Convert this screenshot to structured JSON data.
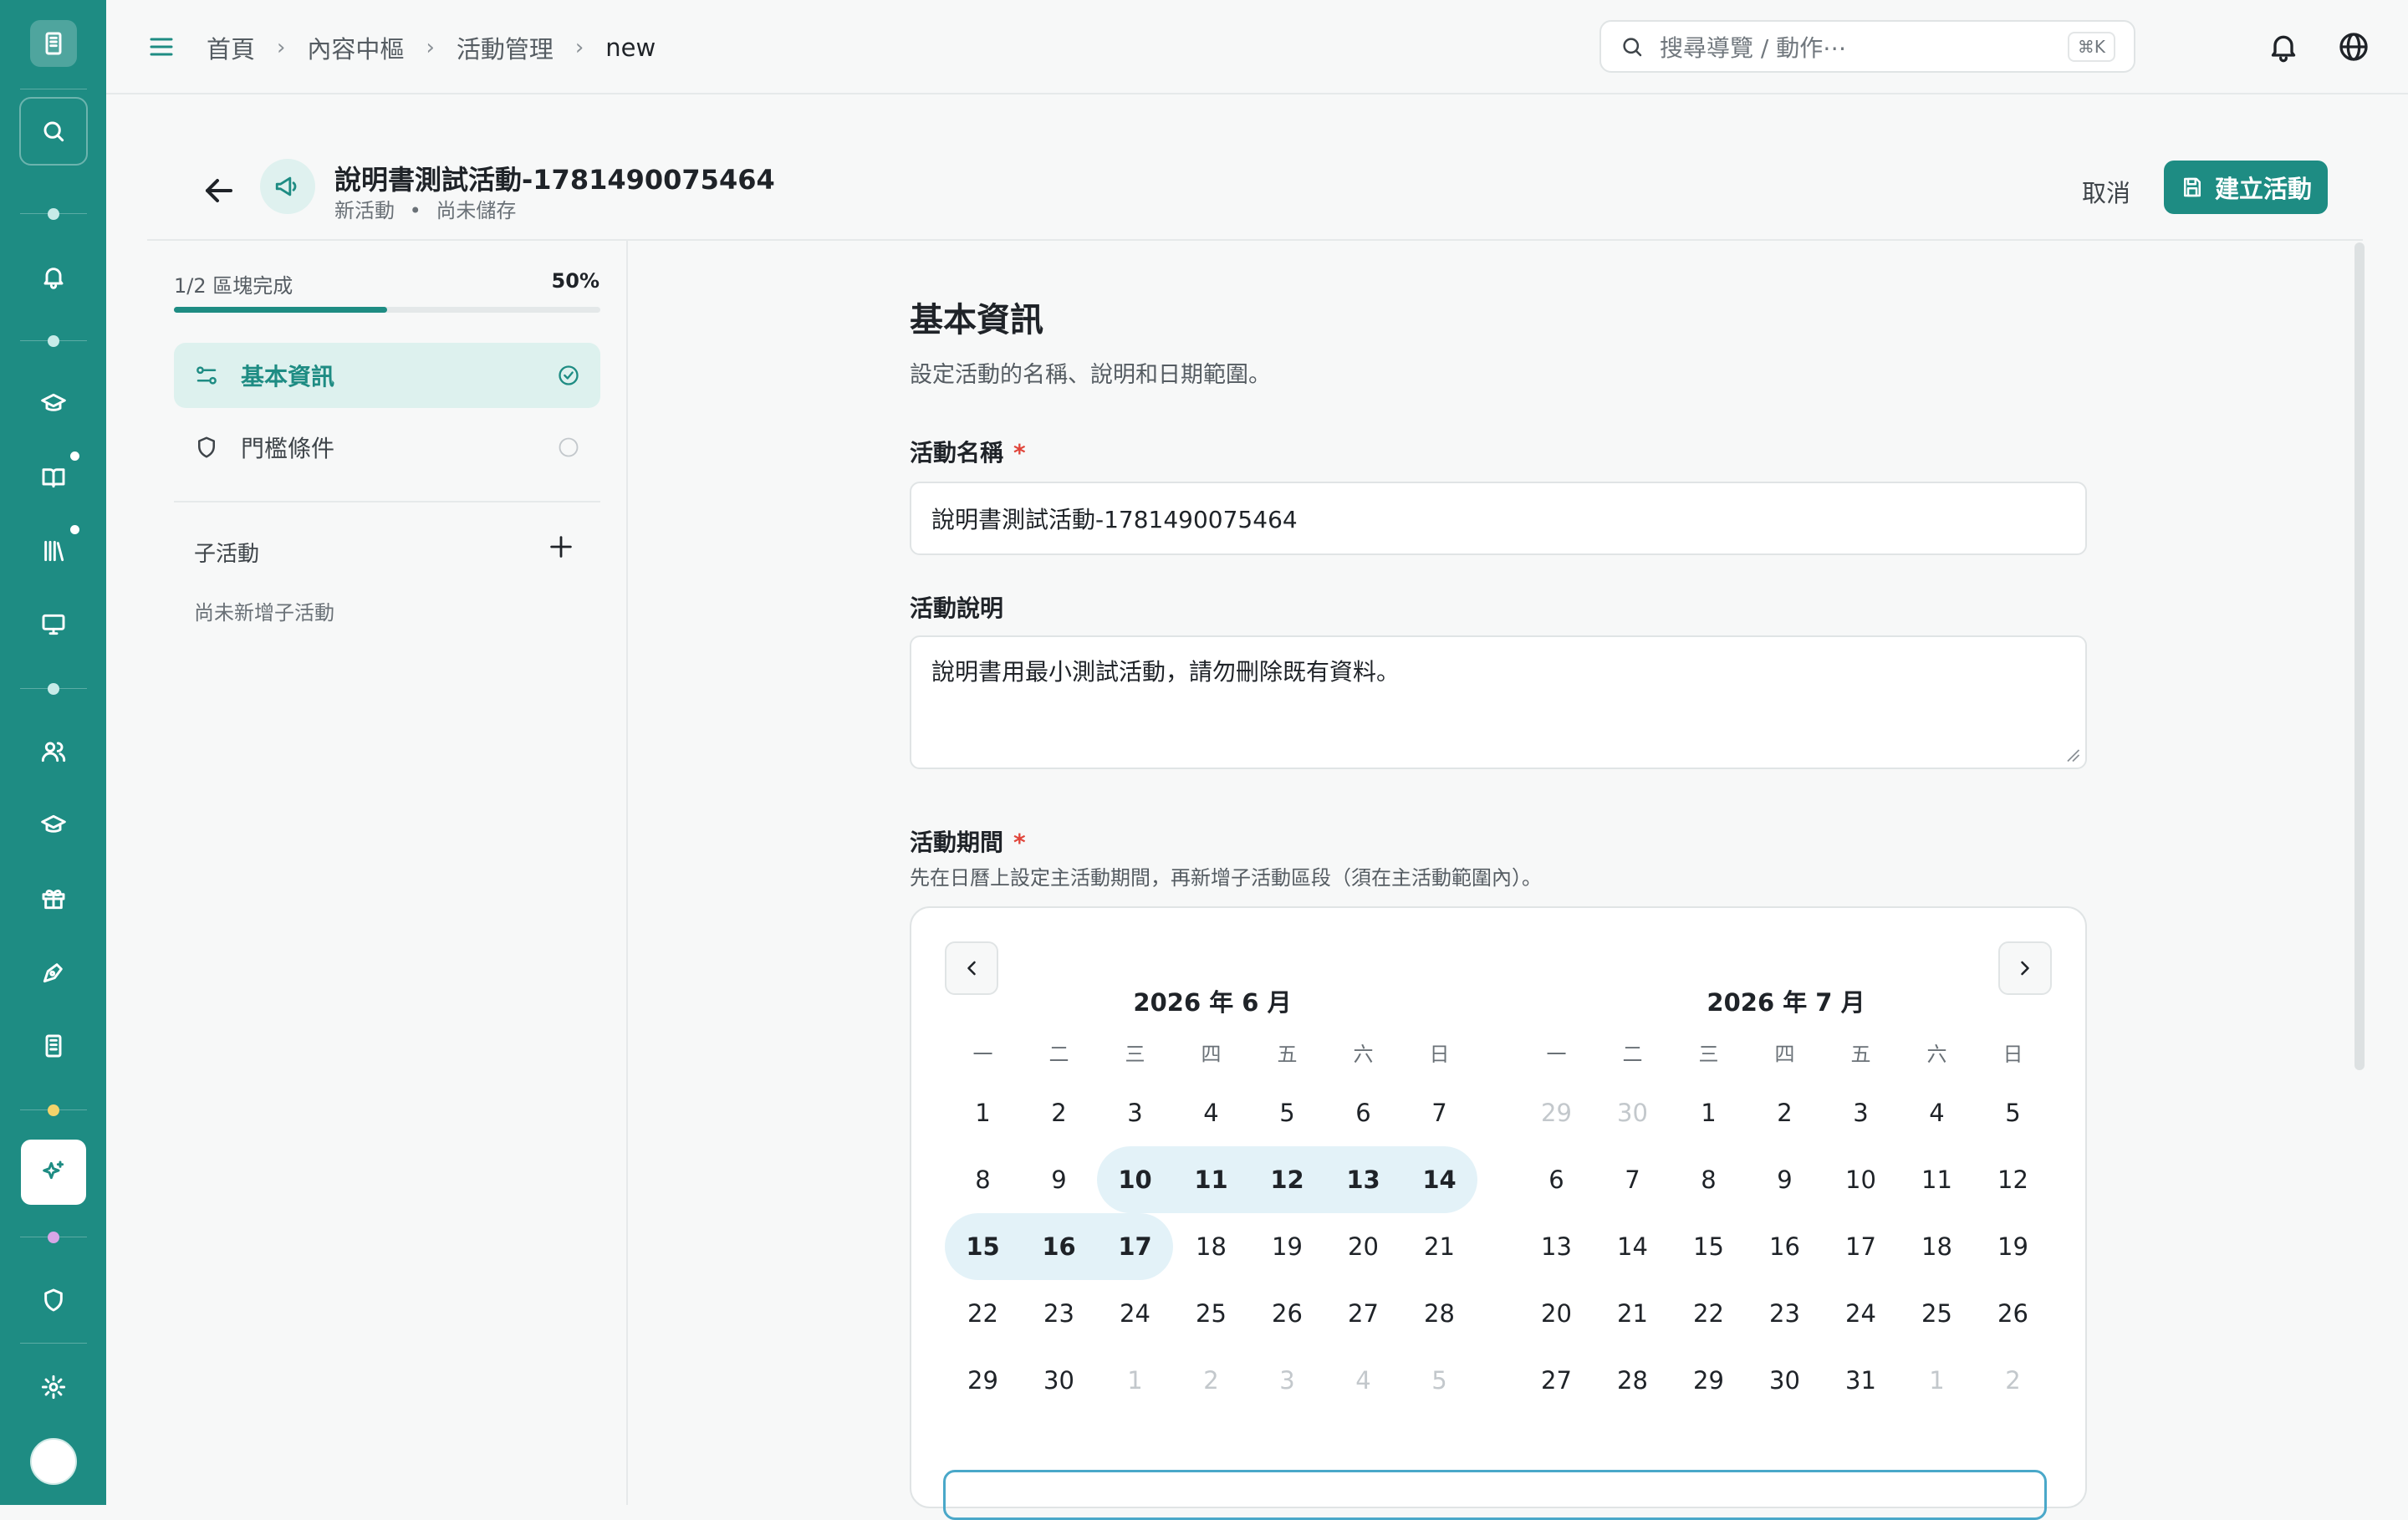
{
  "breadcrumb": {
    "items": [
      "首頁",
      "內容中樞",
      "活動管理"
    ],
    "current": "new"
  },
  "search": {
    "placeholder": "搜尋導覽 / 動作⋯",
    "shortcut": "⌘K"
  },
  "header": {
    "title": "說明書測試活動-1781490075464",
    "status_new": "新活動",
    "status_sep": "•",
    "status_unsaved": "尚未儲存",
    "cancel_label": "取消",
    "create_label": "建立活動"
  },
  "progress": {
    "label": "1/2 區塊完成",
    "percent_text": "50%",
    "value": 0.5
  },
  "sections": [
    {
      "label": "基本資訊",
      "icon": "sliders-icon",
      "status": "complete"
    },
    {
      "label": "門檻條件",
      "icon": "shield-icon",
      "status": "incomplete"
    }
  ],
  "subactivities": {
    "label": "子活動",
    "empty_text": "尚未新增子活動"
  },
  "form": {
    "section_title": "基本資訊",
    "section_desc": "設定活動的名稱、說明和日期範圍。",
    "name_label": "活動名稱",
    "required_mark": "*",
    "name_value": "說明書測試活動-1781490075464",
    "desc_label": "活動說明",
    "desc_value": "說明書用最小測試活動，請勿刪除既有資料。",
    "period_label": "活動期間",
    "period_hint": "先在日曆上設定主活動期間，再新增子活動區段（須在主活動範圍內）。"
  },
  "calendar": {
    "weekdays": [
      "一",
      "二",
      "三",
      "四",
      "五",
      "六",
      "日"
    ],
    "selected_range": {
      "start": "2026-06-10",
      "end": "2026-06-17"
    },
    "months": [
      {
        "title": "2026 年 6 月",
        "days": [
          {
            "d": "1"
          },
          {
            "d": "2"
          },
          {
            "d": "3"
          },
          {
            "d": "4"
          },
          {
            "d": "5"
          },
          {
            "d": "6"
          },
          {
            "d": "7"
          },
          {
            "d": "8"
          },
          {
            "d": "9"
          },
          {
            "d": "10",
            "sel": "start"
          },
          {
            "d": "11",
            "sel": "mid"
          },
          {
            "d": "12",
            "sel": "mid"
          },
          {
            "d": "13",
            "sel": "mid"
          },
          {
            "d": "14",
            "sel": "end"
          },
          {
            "d": "15",
            "sel": "start"
          },
          {
            "d": "16",
            "sel": "mid"
          },
          {
            "d": "17",
            "sel": "end"
          },
          {
            "d": "18"
          },
          {
            "d": "19"
          },
          {
            "d": "20"
          },
          {
            "d": "21"
          },
          {
            "d": "22"
          },
          {
            "d": "23"
          },
          {
            "d": "24"
          },
          {
            "d": "25"
          },
          {
            "d": "26"
          },
          {
            "d": "27"
          },
          {
            "d": "28"
          },
          {
            "d": "29"
          },
          {
            "d": "30"
          },
          {
            "d": "1",
            "muted": true
          },
          {
            "d": "2",
            "muted": true
          },
          {
            "d": "3",
            "muted": true
          },
          {
            "d": "4",
            "muted": true
          },
          {
            "d": "5",
            "muted": true
          }
        ]
      },
      {
        "title": "2026 年 7 月",
        "days": [
          {
            "d": "29",
            "muted": true
          },
          {
            "d": "30",
            "muted": true
          },
          {
            "d": "1"
          },
          {
            "d": "2"
          },
          {
            "d": "3"
          },
          {
            "d": "4"
          },
          {
            "d": "5"
          },
          {
            "d": "6"
          },
          {
            "d": "7"
          },
          {
            "d": "8"
          },
          {
            "d": "9"
          },
          {
            "d": "10"
          },
          {
            "d": "11"
          },
          {
            "d": "12"
          },
          {
            "d": "13"
          },
          {
            "d": "14"
          },
          {
            "d": "15"
          },
          {
            "d": "16"
          },
          {
            "d": "17"
          },
          {
            "d": "18"
          },
          {
            "d": "19"
          },
          {
            "d": "20"
          },
          {
            "d": "21"
          },
          {
            "d": "22"
          },
          {
            "d": "23"
          },
          {
            "d": "24"
          },
          {
            "d": "25"
          },
          {
            "d": "26"
          },
          {
            "d": "27"
          },
          {
            "d": "28"
          },
          {
            "d": "29"
          },
          {
            "d": "30"
          },
          {
            "d": "31"
          },
          {
            "d": "1",
            "muted": true
          },
          {
            "d": "2",
            "muted": true
          }
        ]
      }
    ]
  },
  "colors": {
    "accent": "#1e8c83",
    "sidebar": "#1e8c83",
    "range_highlight": "#e3f2f8",
    "required": "#e0453a"
  }
}
